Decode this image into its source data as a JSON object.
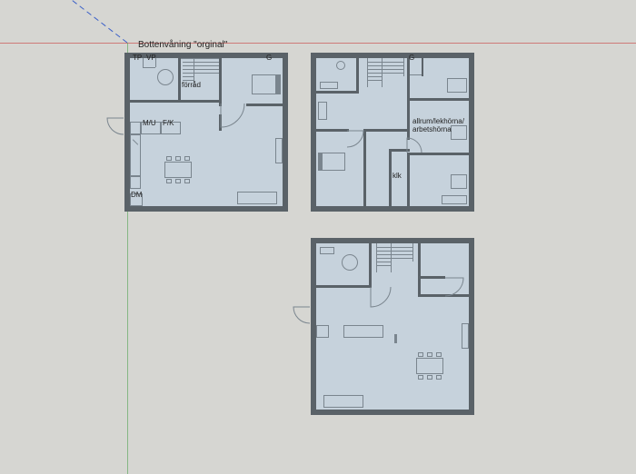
{
  "title": "Bottenvåning \"orginal\"",
  "planA": {
    "labels": {
      "tp": "TP",
      "vp": "VP",
      "forrad": "förråd",
      "g": "G",
      "mu": "M/U",
      "fk": "F/K",
      "dm": "DM"
    }
  },
  "planB": {
    "labels": {
      "g": "G",
      "klk": "klk",
      "allrum": "allrum/lekhörna/\narbetshörna"
    }
  }
}
